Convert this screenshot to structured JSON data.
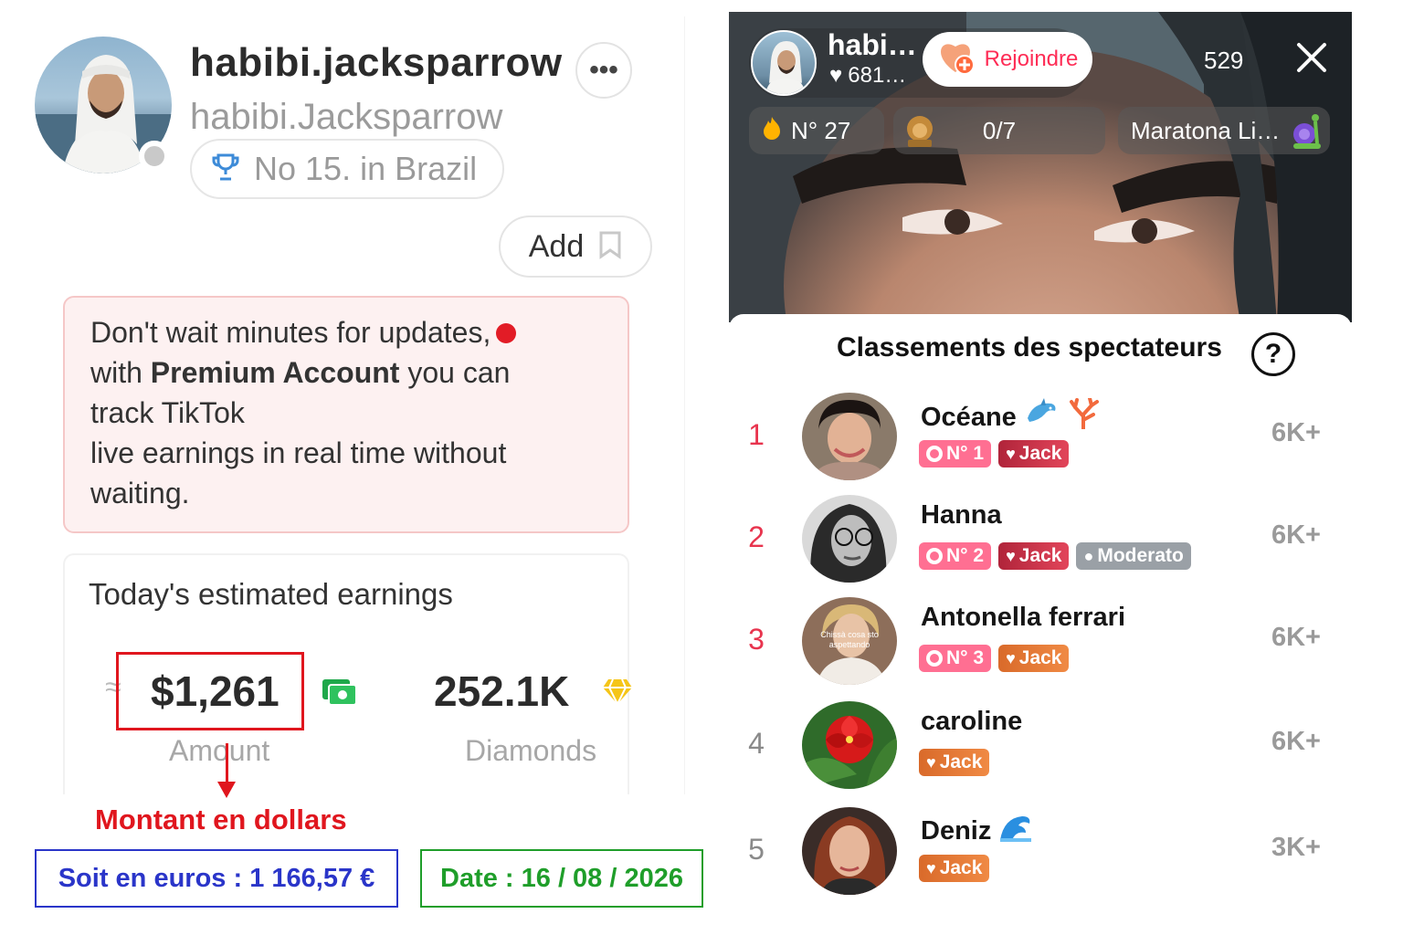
{
  "profile": {
    "username": "habibi.jacksparrow",
    "handle": "habibi.Jacksparrow",
    "rank_label": "No 15. in Brazil",
    "more_label": "•••",
    "add_label": "Add"
  },
  "promo": {
    "line1": "Don't wait minutes for updates,",
    "line2_pre": "with ",
    "line2_bold": "Premium Account",
    "line2_post": " you can",
    "line3_pre": "track ",
    "line3_bold": "TikTok",
    "line4": "live earnings in real time without",
    "line5": "waiting."
  },
  "earnings": {
    "title": "Today's estimated earnings",
    "approx_symbol": "≈",
    "amount": "$1,261",
    "amount_caption": "Amount",
    "diamonds": "252.1K",
    "diamonds_caption": "Diamonds"
  },
  "annotations": {
    "dollar_label": "Montant en dollars",
    "euro_label": "Soit en euros : 1 166,57 €",
    "date_label": "Date : 16 / 08 / 2026",
    "colors": {
      "red": "#e0161e",
      "blue": "#2a35c9",
      "green": "#1f9e2a"
    }
  },
  "live": {
    "host_name": "habi…",
    "host_likes": "681…",
    "join_label": "Rejoindre",
    "viewer_count": "529",
    "rank_chip": "N° 27",
    "goal_chip": "0/7",
    "marathon_chip": "Maratona Li…"
  },
  "ranking": {
    "title": "Classements des spectateurs",
    "help_label": "?",
    "viewers": [
      {
        "pos": "1",
        "name": "Océane",
        "score": "6K+",
        "badges": [
          "N° 1",
          "Jack"
        ]
      },
      {
        "pos": "2",
        "name": "Hanna",
        "score": "6K+",
        "badges": [
          "N° 2",
          "Jack",
          "Moderato"
        ]
      },
      {
        "pos": "3",
        "name": "Antonella ferrari",
        "score": "6K+",
        "badges": [
          "N° 3",
          "Jack"
        ],
        "avatar_text": "Chissà cosa sto aspettando"
      },
      {
        "pos": "4",
        "name": "caroline",
        "score": "6K+",
        "badges": [
          "Jack"
        ]
      },
      {
        "pos": "5",
        "name": "Deniz",
        "score": "3K+",
        "badges": [
          "Jack"
        ]
      }
    ],
    "colors": {
      "top3": "#e8344e",
      "rest": "#8a8a8a"
    }
  }
}
